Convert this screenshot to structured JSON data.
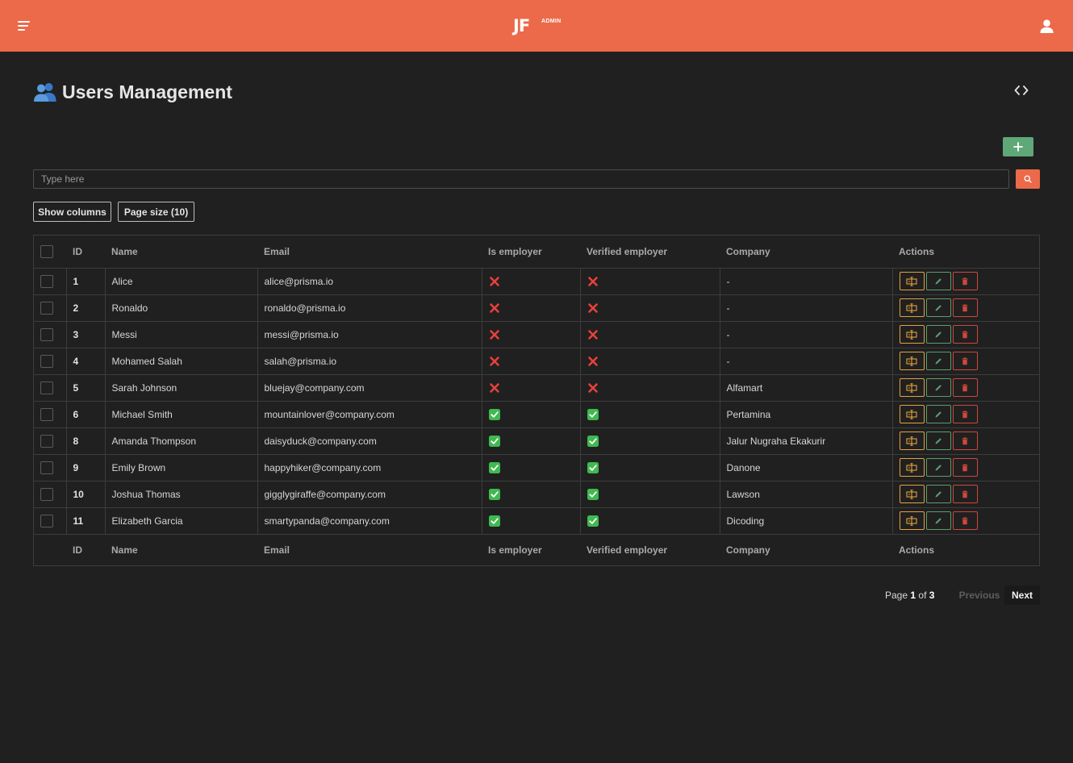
{
  "header": {
    "logo": "JF",
    "logo_subtitle": "ADMIN",
    "accent_color": "#ec6a49"
  },
  "page": {
    "title": "Users Management",
    "title_icon": "users-icon"
  },
  "toolbar": {
    "add_icon": "plus-icon",
    "search_placeholder": "Type here",
    "search_value": "",
    "search_icon": "search-icon",
    "show_columns_label": "Show columns",
    "page_size_label": "Page size (10)"
  },
  "table": {
    "columns": [
      "ID",
      "Name",
      "Email",
      "Is employer",
      "Verified employer",
      "Company",
      "Actions"
    ],
    "rows": [
      {
        "id": "1",
        "name": "Alice",
        "email": "alice@prisma.io",
        "is_employer": false,
        "verified_employer": false,
        "company": "-"
      },
      {
        "id": "2",
        "name": "Ronaldo",
        "email": "ronaldo@prisma.io",
        "is_employer": false,
        "verified_employer": false,
        "company": "-"
      },
      {
        "id": "3",
        "name": "Messi",
        "email": "messi@prisma.io",
        "is_employer": false,
        "verified_employer": false,
        "company": "-"
      },
      {
        "id": "4",
        "name": "Mohamed Salah",
        "email": "salah@prisma.io",
        "is_employer": false,
        "verified_employer": false,
        "company": "-"
      },
      {
        "id": "5",
        "name": "Sarah Johnson",
        "email": "bluejay@company.com",
        "is_employer": false,
        "verified_employer": false,
        "company": "Alfamart"
      },
      {
        "id": "6",
        "name": "Michael Smith",
        "email": "mountainlover@company.com",
        "is_employer": true,
        "verified_employer": true,
        "company": "Pertamina"
      },
      {
        "id": "8",
        "name": "Amanda Thompson",
        "email": "daisyduck@company.com",
        "is_employer": true,
        "verified_employer": true,
        "company": "Jalur Nugraha Ekakurir"
      },
      {
        "id": "9",
        "name": "Emily Brown",
        "email": "happyhiker@company.com",
        "is_employer": true,
        "verified_employer": true,
        "company": "Danone"
      },
      {
        "id": "10",
        "name": "Joshua Thomas",
        "email": "gigglygiraffe@company.com",
        "is_employer": true,
        "verified_employer": true,
        "company": "Lawson"
      },
      {
        "id": "11",
        "name": "Elizabeth Garcia",
        "email": "smartypanda@company.com",
        "is_employer": true,
        "verified_employer": true,
        "company": "Dicoding"
      }
    ],
    "actions": [
      {
        "name": "view",
        "icon": "view-details-icon",
        "color": "#e3a23f"
      },
      {
        "name": "edit",
        "icon": "pencil-icon",
        "color": "#5a9e6f"
      },
      {
        "name": "delete",
        "icon": "trash-icon",
        "color": "#d0473a"
      }
    ],
    "true_color": "#3fb950",
    "false_color": "#e5413a"
  },
  "pagination": {
    "page_prefix": "Page",
    "current_page": "1",
    "of_label": "of",
    "total_pages": "3",
    "previous_label": "Previous",
    "next_label": "Next"
  }
}
